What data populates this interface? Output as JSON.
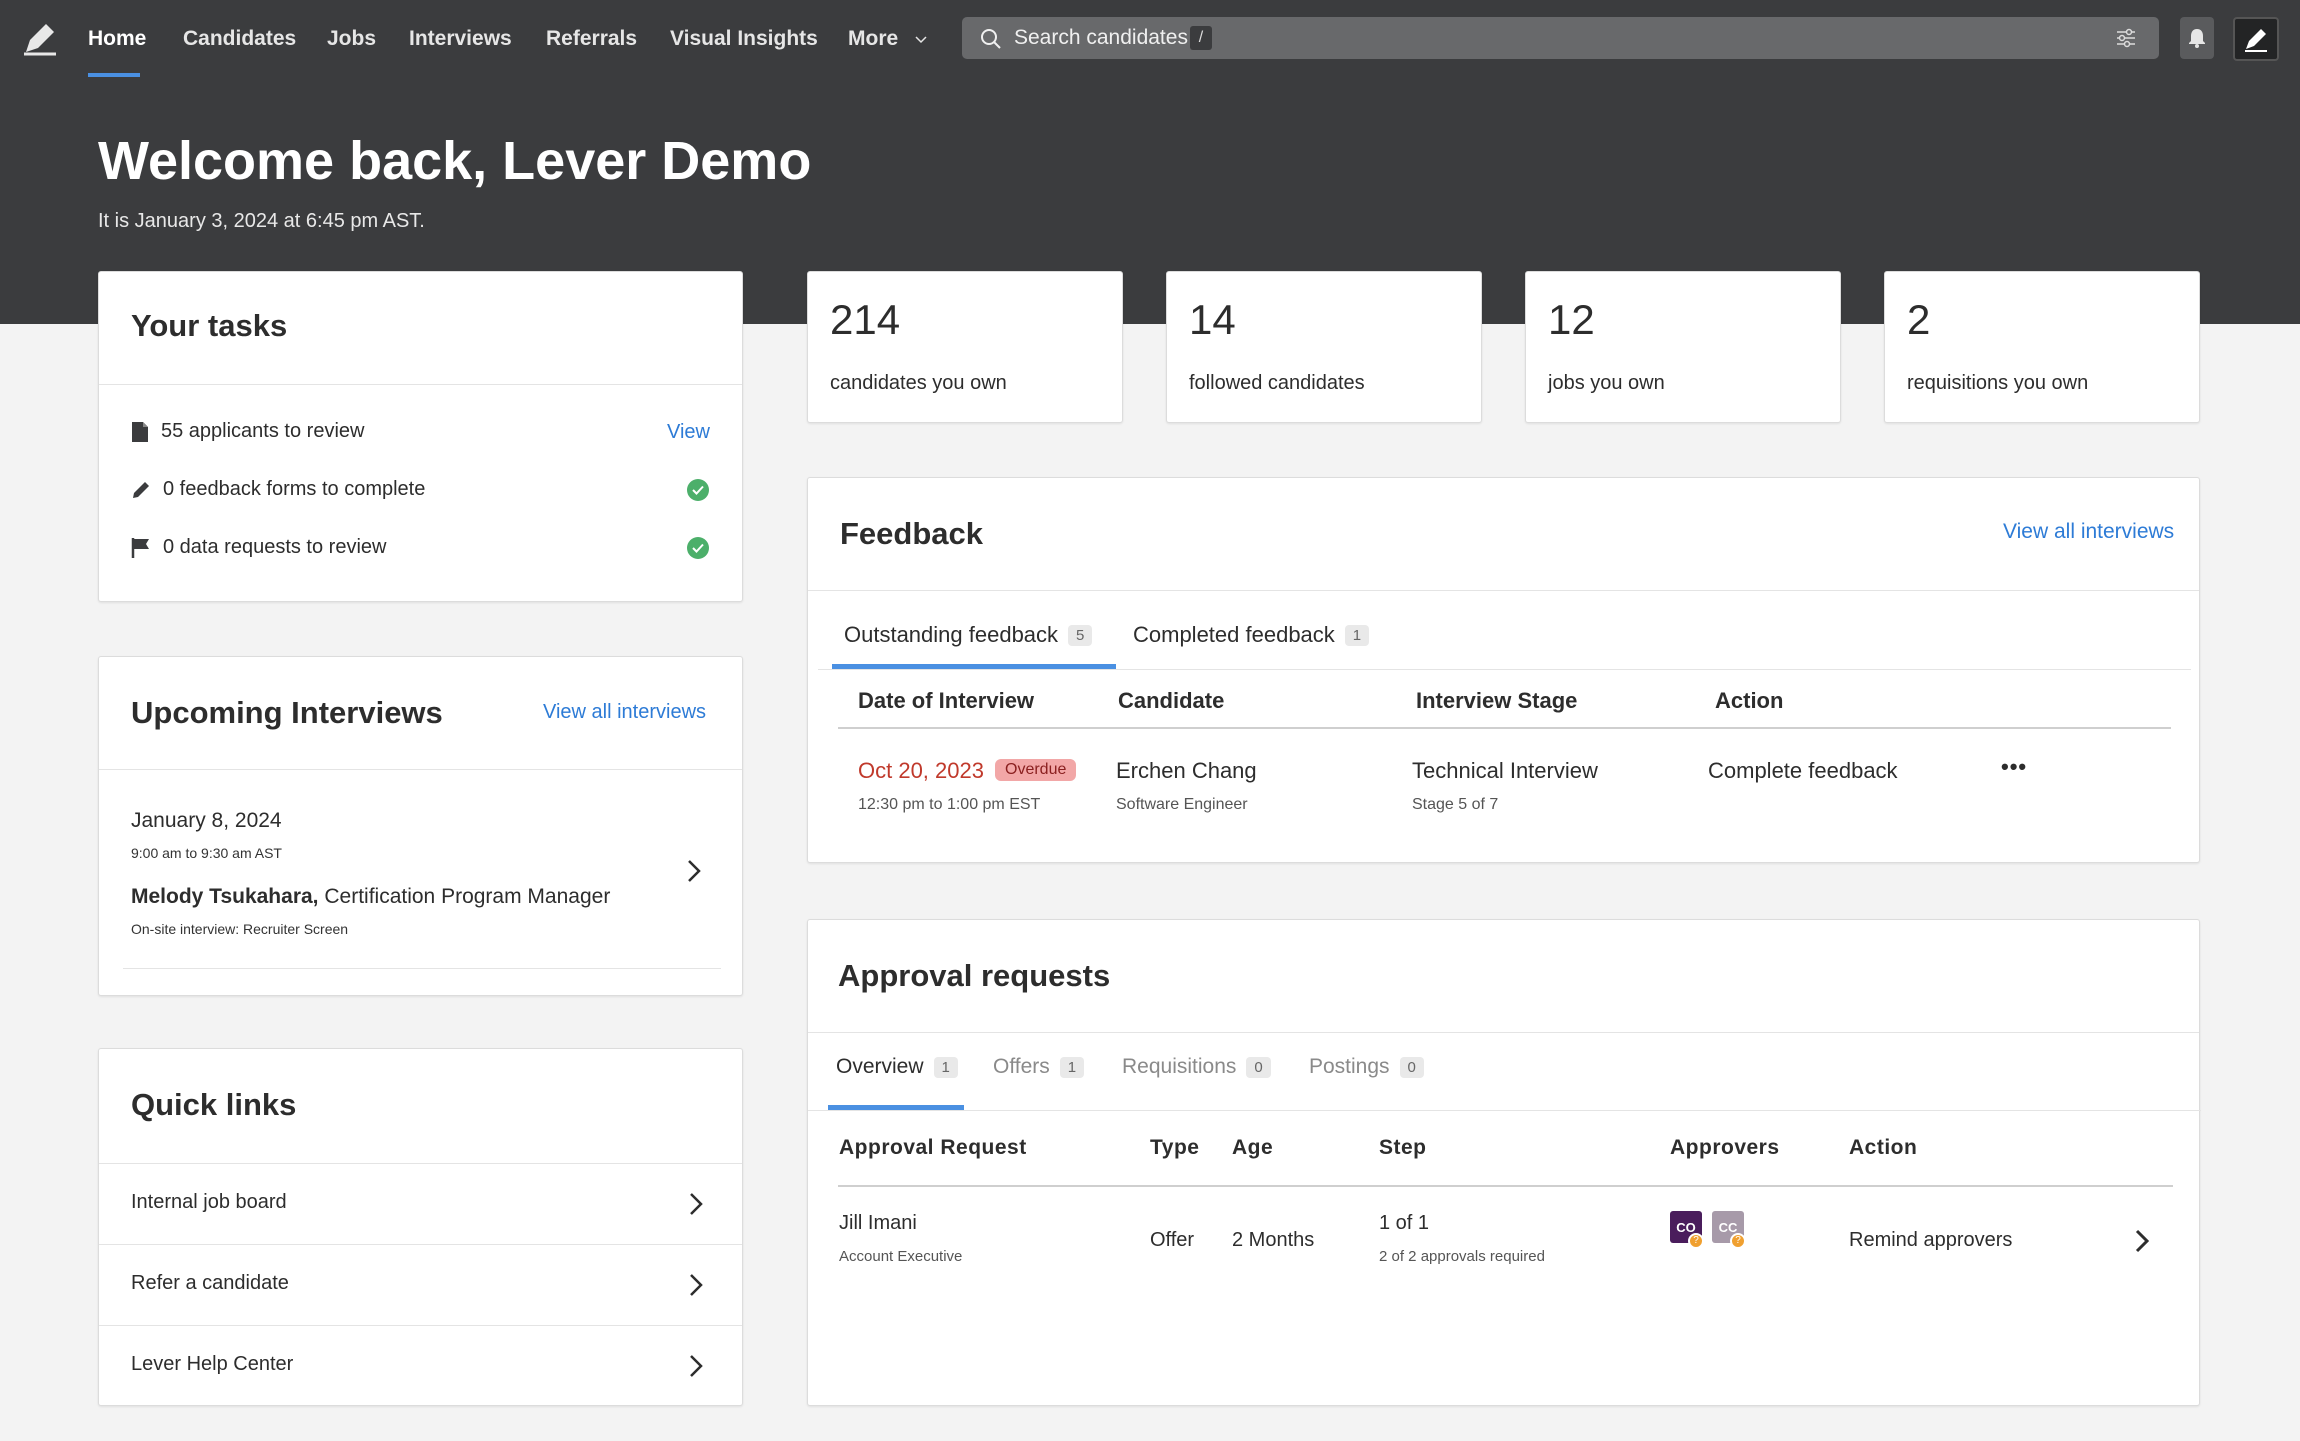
{
  "nav": {
    "items": [
      "Home",
      "Candidates",
      "Jobs",
      "Interviews",
      "Referrals",
      "Visual Insights",
      "More"
    ],
    "search_placeholder": "Search candidates",
    "search_shortcut": "/"
  },
  "header": {
    "title": "Welcome back, Lever Demo",
    "subtitle": "It is January 3, 2024 at 6:45 pm AST."
  },
  "stats": [
    {
      "value": "214",
      "label": "candidates you own"
    },
    {
      "value": "14",
      "label": "followed candidates"
    },
    {
      "value": "12",
      "label": "jobs you own"
    },
    {
      "value": "2",
      "label": "requisitions you own"
    }
  ],
  "tasks": {
    "title": "Your tasks",
    "items": [
      {
        "text": "55 applicants to review",
        "action": "View",
        "icon": "document-icon"
      },
      {
        "text": "0 feedback forms to complete",
        "icon": "pencil-icon"
      },
      {
        "text": "0 data requests to review",
        "icon": "flag-icon"
      }
    ]
  },
  "upcoming": {
    "title": "Upcoming Interviews",
    "view_all": "View all interviews",
    "date": "January 8, 2024",
    "time": "9:00 am to 9:30 am AST",
    "candidate": "Melody Tsukahara,",
    "role": "Certification Program Manager",
    "detail": "On-site interview: Recruiter Screen"
  },
  "quick_links": {
    "title": "Quick links",
    "items": [
      "Internal job board",
      "Refer a candidate",
      "Lever Help Center"
    ]
  },
  "feedback": {
    "title": "Feedback",
    "view_all": "View all interviews",
    "tabs": [
      {
        "label": "Outstanding feedback",
        "count": "5"
      },
      {
        "label": "Completed feedback",
        "count": "1"
      }
    ],
    "headers": [
      "Date of Interview",
      "Candidate",
      "Interview Stage",
      "Action"
    ],
    "row": {
      "date": "Oct 20, 2023",
      "overdue": "Overdue",
      "time": "12:30 pm to 1:00 pm EST",
      "candidate": "Erchen Chang",
      "candidate_role": "Software Engineer",
      "stage": "Technical Interview",
      "stage_sub": "Stage 5 of 7",
      "action": "Complete feedback",
      "more": "•••"
    }
  },
  "approvals": {
    "title": "Approval requests",
    "tabs": [
      {
        "label": "Overview",
        "count": "1"
      },
      {
        "label": "Offers",
        "count": "1"
      },
      {
        "label": "Requisitions",
        "count": "0"
      },
      {
        "label": "Postings",
        "count": "0"
      }
    ],
    "headers": [
      "Approval Request",
      "Type",
      "Age",
      "Step",
      "Approvers",
      "Action"
    ],
    "row": {
      "name": "Jill Imani",
      "role": "Account Executive",
      "type": "Offer",
      "age": "2 Months",
      "step": "1 of 1",
      "step_sub": "2 of 2 approvals required",
      "approvers": [
        "CO",
        "CC"
      ],
      "action": "Remind approvers"
    }
  },
  "colors": {
    "accent": "#4a90e2",
    "link": "#2d7bd6",
    "hero": "#3b3c3e",
    "overdue": "#c0392b",
    "success": "#4caf6a"
  }
}
